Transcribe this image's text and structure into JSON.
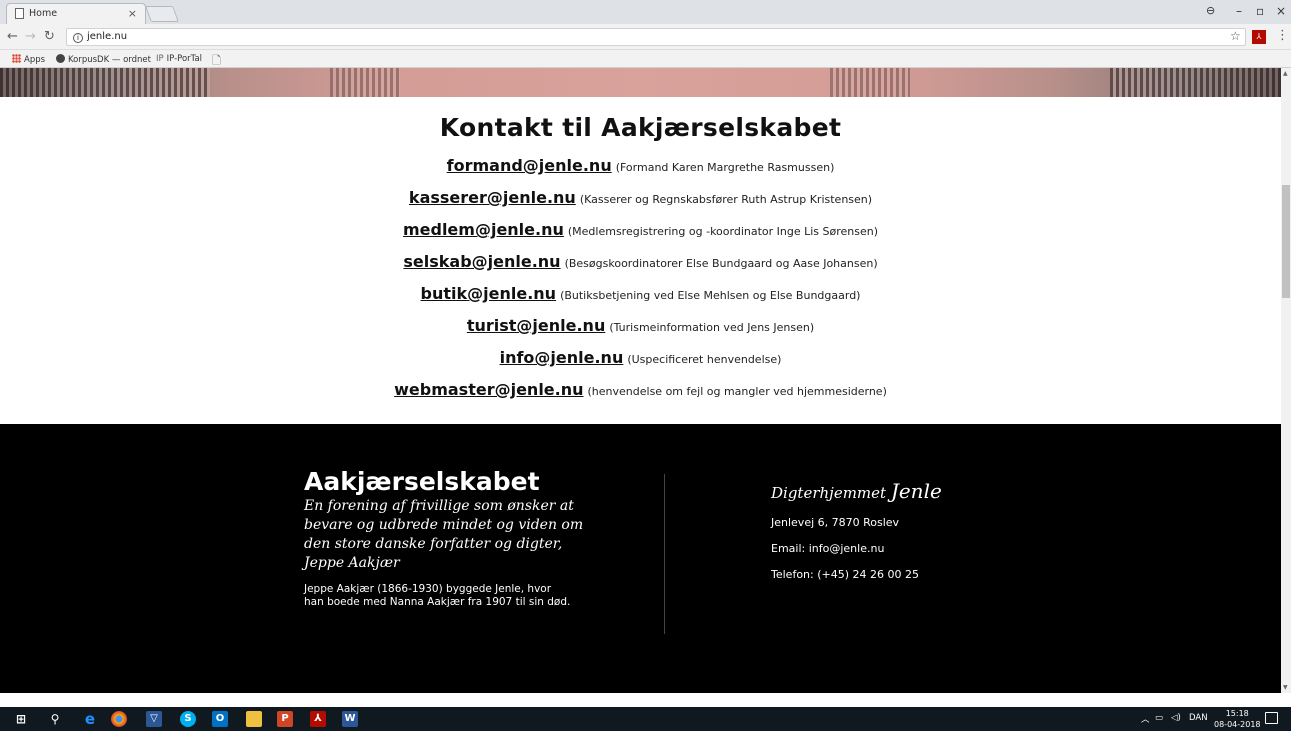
{
  "browser": {
    "tab_title": "Home",
    "tab_close": "×",
    "url": "jenle.nu",
    "bookmarks": [
      {
        "label": "Apps"
      },
      {
        "label": "KorpusDK — ordnet"
      },
      {
        "label": "IP-PorTal"
      }
    ],
    "window_controls": {
      "minimize": "–",
      "restore": "ơ",
      "close": "×"
    }
  },
  "contact": {
    "title": "Kontakt til Aakjærselskabet",
    "entries": [
      {
        "email": "formand@jenle.nu",
        "desc": "(Formand Karen Margrethe Rasmussen)"
      },
      {
        "email": "kasserer@jenle.nu",
        "desc": "(Kasserer og Regnskabsfører Ruth Astrup Kristensen)"
      },
      {
        "email": "medlem@jenle.nu",
        "desc": "(Medlemsregistrering og -koordinator Inge Lis Sørensen)"
      },
      {
        "email": "selskab@jenle.nu",
        "desc": "(Besøgskoordinatorer Else Bundgaard og Aase Johansen)"
      },
      {
        "email": "butik@jenle.nu",
        "desc": "(Butiksbetjening ved Else Mehlsen og Else Bundgaard)"
      },
      {
        "email": "turist@jenle.nu",
        "desc": "(Turismeinformation ved Jens Jensen)"
      },
      {
        "email": "info@jenle.nu",
        "desc": "(Uspecificeret henvendelse)"
      },
      {
        "email": "webmaster@jenle.nu",
        "desc": "(henvendelse om fejl og mangler ved hjemmesiderne)"
      }
    ]
  },
  "footer": {
    "left": {
      "title": "Aakjærselskabet",
      "tagline": "En forening af frivillige som ønsker at bevare og udbrede mindet og viden om den store danske forfatter og digter, Jeppe Aakjær",
      "about": "Jeppe Aakjær (1866-1930) byggede Jenle, hvor han boede med Nanna Aakjær fra 1907 til sin død."
    },
    "right": {
      "title_prefix": "Digterhjemmet",
      "title_name": "Jenle",
      "address": "Jenlevej 6, 7870 Roslev",
      "email": "Email: info@jenle.nu",
      "phone": "Telefon: (+45) 24 26 00 25"
    }
  },
  "taskbar": {
    "language": "DAN",
    "time": "15:18",
    "date": "08-04-2018"
  },
  "colors": {
    "footer_bg": "#000000",
    "text": "#111111"
  }
}
